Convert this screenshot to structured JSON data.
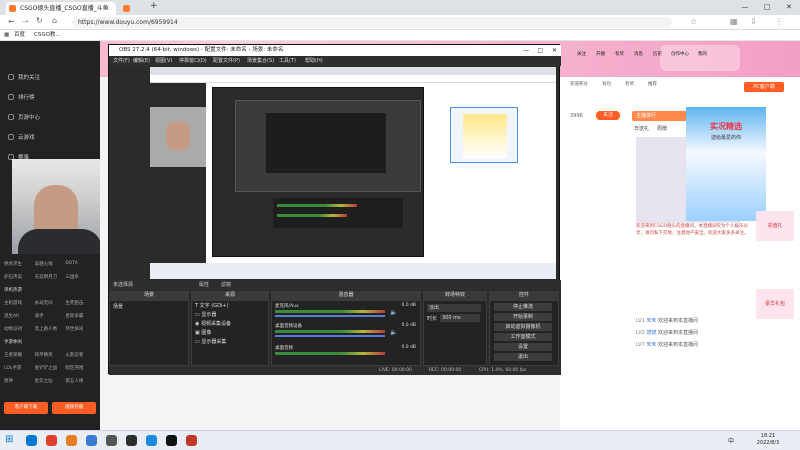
{
  "browser": {
    "tabs": [
      {
        "label": "CSGO德头直播_CSGO直播_斗鱼",
        "active": true
      },
      {
        "label": "",
        "active": false
      }
    ],
    "new_tab": "+",
    "url": "https://www.douyu.com/6959914",
    "bookmarks": [
      "百度",
      "CSGO教..."
    ],
    "window_controls": [
      "—",
      "□",
      "✕"
    ]
  },
  "douyu": {
    "sidebar": {
      "items": [
        "我的关注",
        "排行榜",
        "页游中心",
        "云游戏",
        "赛事"
      ],
      "categories": [
        [
          "绝地求生",
          "穿越火线",
          "DOTA"
        ],
        [
          "炉石传说",
          "天涯明月刀",
          "三国杀"
        ],
        [
          "单机热游",
          ""
        ],
        [
          "主机游戏",
          "永劫无间",
          "生死狙击"
        ],
        [
          "逃生AR",
          "骑手",
          "星际争霸"
        ],
        [
          "动物派对",
          "黑上路人秀",
          "环世屏间"
        ],
        [
          "手游休闲",
          ""
        ],
        [
          "王者荣耀",
          "和平精英",
          "火影忍者"
        ],
        [
          "LOL手游",
          "金铲铲之战",
          "暗区突围"
        ],
        [
          "原神",
          "星云之仙",
          "第五人格"
        ]
      ],
      "download_btn": "客户端下载",
      "record_btn": "视频开播"
    },
    "header_icons": [
      "关注",
      "开播",
      "有奖",
      "消息",
      "历史",
      "创作中心",
      "我的"
    ],
    "header_icons2": [
      "充值积分",
      "背包",
      "有奖",
      "推荐"
    ],
    "pc_client_btn": "PC客户端",
    "hot_rank": "主播排行",
    "rank_tabs": [
      "日送礼",
      "周榜"
    ],
    "fans_count": "3996",
    "fans_btn": "关注",
    "chat": [
      {
        "level": "LV1",
        "user": "朱朱",
        "text": "欢迎来到本直播间"
      },
      {
        "level": "LV2",
        "user": "德德",
        "text": "欢迎来到本直播间"
      },
      {
        "level": "LV7",
        "user": "朱朱",
        "text": "欢迎来到本直播间"
      }
    ],
    "notice": "欢迎来到CSGO德头的直播间，本直播间仅为个人娱乐分享，请勿私下交易，注意财产安全。欢迎大家多多关注。",
    "promo_title": "实况精选",
    "promo_sub": "送给最爱的你",
    "charge_label": "充值礼",
    "sidebar_gift": "豪华礼包"
  },
  "obs": {
    "title": "OBS 27.2.4 (64-bit, windows) - 配置文件: 未命名 - 场景: 未命名",
    "menu": [
      "文件(F)",
      "编辑(E)",
      "视图(V)",
      "停靠窗口(D)",
      "配置文件(P)",
      "场景集合(S)",
      "工具(T)",
      "帮助(H)"
    ],
    "no_source": "未选择源",
    "props_btn": "属性",
    "filter_btn": "滤镜",
    "docks": {
      "scenes": {
        "title": "场景",
        "items": [
          "场景"
        ]
      },
      "sources": {
        "title": "来源",
        "items": [
          "文字 (GDI+)",
          "显示器",
          "视频采集设备",
          "图像",
          "显示器采集"
        ]
      },
      "mixer": {
        "title": "混音器",
        "channels": [
          {
            "name": "麦克风/Aux",
            "db": "0.0 dB"
          },
          {
            "name": "桌面音频设备",
            "db": "0.0 dB"
          },
          {
            "name": "桌面音频",
            "db": "0.0 dB"
          }
        ]
      },
      "transitions": {
        "title": "转场特效",
        "type": "淡出",
        "duration_label": "时长",
        "duration": "300 ms"
      },
      "controls": {
        "title": "控件",
        "buttons": [
          "停止推流",
          "开始录制",
          "启动虚拟摄像机",
          "工作室模式",
          "设置",
          "退出"
        ]
      }
    },
    "status": {
      "live": "LIVE: 00:00:00",
      "rec": "REC: 00:00:00",
      "cpu": "CPU: 1.4%, 60.00 fps"
    }
  },
  "taskbar": {
    "time": "18:21",
    "date": "2022/8/3",
    "lang": "中",
    "icon_colors": [
      "#0078d4",
      "#e33e2b",
      "#e67e22",
      "#3a7bd5",
      "#555555",
      "#2c2c2c",
      "#1d8ce0",
      "#111111",
      "#c0392b"
    ]
  },
  "colors": {
    "douyu_orange": "#ff5d23",
    "obs_bg": "#2b2b2b",
    "sidebar_bg": "#222222",
    "banner_pink": "#f7a8c8"
  }
}
